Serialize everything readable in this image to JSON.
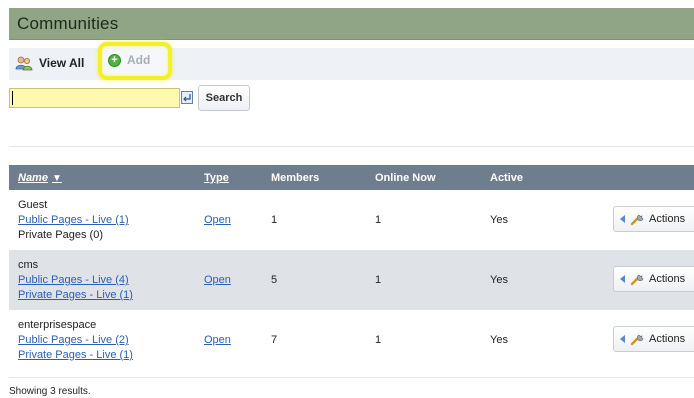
{
  "page": {
    "title": "Communities"
  },
  "toolbar": {
    "view_all_label": "View All",
    "add_label": "Add",
    "view_all_icon": "people-icon",
    "add_icon": "plus-circle-icon"
  },
  "search": {
    "value": "",
    "button_label": "Search"
  },
  "table": {
    "columns": {
      "name": "Name",
      "type": "Type",
      "members": "Members",
      "online": "Online Now",
      "active": "Active"
    },
    "sort_indicator": "▼",
    "rows": [
      {
        "name": "Guest",
        "public_pages": "Public Pages - Live (1)",
        "private_pages": "Private Pages (0)",
        "type": "Open",
        "members": "1",
        "online": "1",
        "active": "Yes",
        "actions_label": "Actions"
      },
      {
        "name": "cms",
        "public_pages": "Public Pages - Live (4)",
        "private_pages": "Private Pages - Live (1)",
        "type": "Open",
        "members": "5",
        "online": "1",
        "active": "Yes",
        "actions_label": "Actions"
      },
      {
        "name": "enterprisespace",
        "public_pages": "Public Pages - Live (2)",
        "private_pages": "Private Pages - Live (1)",
        "type": "Open",
        "members": "7",
        "online": "1",
        "active": "Yes",
        "actions_label": "Actions"
      }
    ]
  },
  "footer": {
    "results_text": "Showing 3 results."
  },
  "colors": {
    "title_bar": "#8fa585",
    "header_bar": "#6f7e8e",
    "alt_row": "#dfe2e7",
    "link": "#2c5fb3",
    "highlight": "#f2f02a"
  }
}
